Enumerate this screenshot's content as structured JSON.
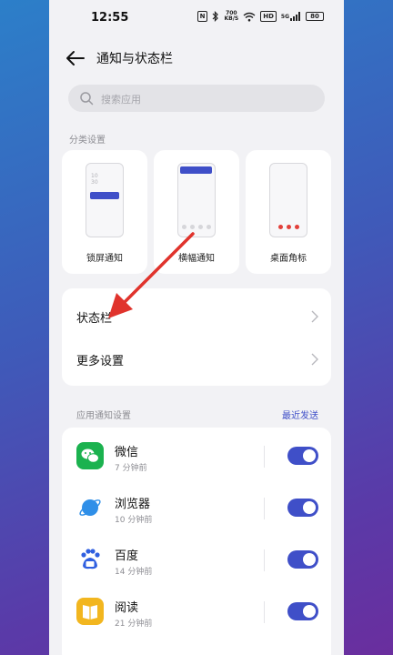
{
  "status_bar": {
    "time": "12:55",
    "nfc": "N",
    "net_speed": "700\nKB/S",
    "hd_label": "HD",
    "signal_label": "5G",
    "battery": "80"
  },
  "header": {
    "title": "通知与状态栏"
  },
  "search": {
    "placeholder": "搜索应用"
  },
  "categories": {
    "label": "分类设置",
    "items": [
      {
        "label": "锁屏通知",
        "clock": "10\n30"
      },
      {
        "label": "横幅通知"
      },
      {
        "label": "桌面角标"
      }
    ]
  },
  "settings_group": {
    "items": [
      {
        "label": "状态栏"
      },
      {
        "label": "更多设置"
      }
    ]
  },
  "app_notifications": {
    "label": "应用通知设置",
    "link": "最近发送",
    "apps": [
      {
        "name": "微信",
        "time": "7 分钟前",
        "enabled": true
      },
      {
        "name": "浏览器",
        "time": "10 分钟前",
        "enabled": true
      },
      {
        "name": "百度",
        "time": "14 分钟前",
        "enabled": true
      },
      {
        "name": "阅读",
        "time": "21 分钟前",
        "enabled": true
      }
    ]
  },
  "colors": {
    "accent": "#3f4fc8",
    "page_bg": "#f2f2f5",
    "annotation_arrow": "#e0332c",
    "wechat": "#1bb24f",
    "browser": "#2f8fe8",
    "baidu": "#2f5fe0",
    "reader": "#f2b61f"
  },
  "icons": {
    "back": "arrow-left-icon",
    "search": "search-icon",
    "chevron": "chevron-right-icon"
  }
}
